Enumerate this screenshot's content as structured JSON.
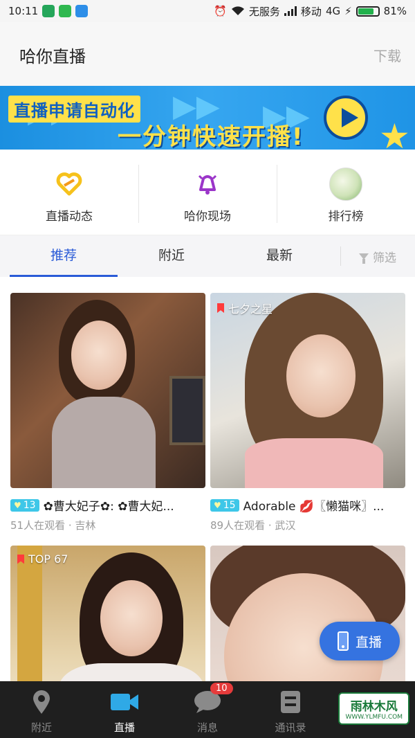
{
  "status_bar": {
    "time": "10:11",
    "alarm_icon": "alarm-icon",
    "wifi_icon": "wifi-icon",
    "no_service": "无服务",
    "carrier": "移动",
    "network": "4G",
    "battery": "81%",
    "battery_level": 0.81
  },
  "header": {
    "title": "哈你直播",
    "download": "下载"
  },
  "banner": {
    "line1": "直播申请自动化",
    "line2": "一分钟快速开播!"
  },
  "quick_nav": [
    {
      "label": "直播动态",
      "icon": "heart-icon"
    },
    {
      "label": "哈你现场",
      "icon": "bell-icon"
    },
    {
      "label": "排行榜",
      "icon": "ranking-avatar"
    }
  ],
  "tabs": {
    "items": [
      "推荐",
      "附近",
      "最新"
    ],
    "active": 0,
    "filter": "筛选"
  },
  "feed": [
    {
      "tag": "",
      "level": "13",
      "name": "✿曹大妃子✿: ✿曹大妃...",
      "viewers": "51人在观看",
      "city": "吉林"
    },
    {
      "tag": "七夕之星",
      "level": "15",
      "name": "Adorable 💋〖懒猫咪〗...",
      "viewers": "89人在观看",
      "city": "武汉"
    },
    {
      "tag": "TOP 67"
    },
    {
      "tag": ""
    }
  ],
  "fab": {
    "label": "直播"
  },
  "bottom_nav": {
    "items": [
      "附近",
      "直播",
      "消息",
      "通讯录"
    ],
    "active": 1,
    "message_badge": "10"
  },
  "watermark": {
    "main": "雨林木风",
    "url": "WWW.YLMFU.COM"
  },
  "colors": {
    "accent": "#2a5bd7",
    "fab": "#3573e0",
    "level_badge": "#3ec7e8",
    "bottom_bar": "#1f1f1f"
  }
}
